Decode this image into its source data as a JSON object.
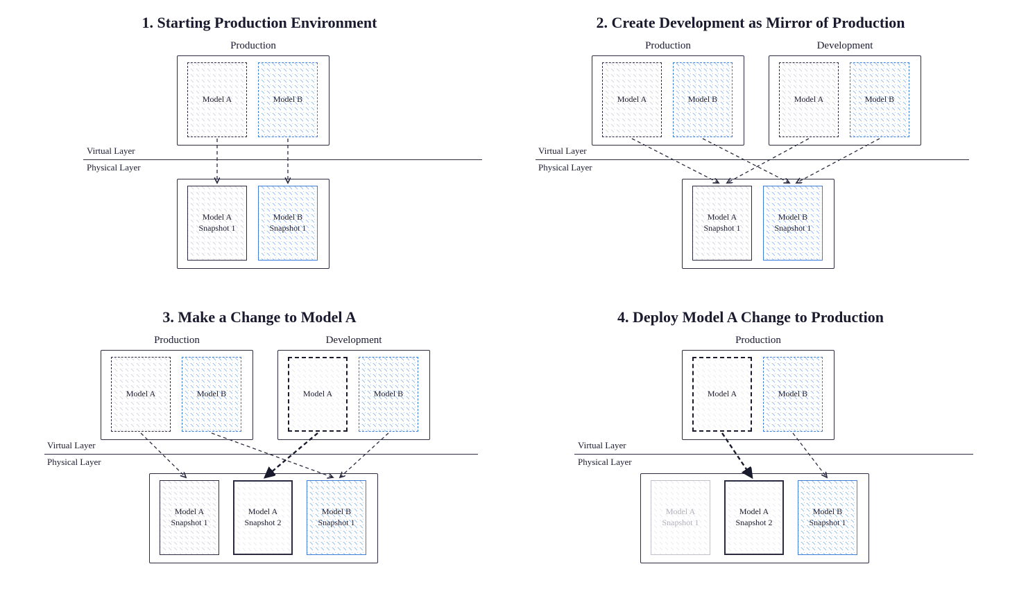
{
  "panels": {
    "p1": {
      "title": "1. Starting Production Environment",
      "envs": {
        "prod": "Production"
      },
      "models": {
        "a": "Model A",
        "b": "Model B",
        "as1": "Model A\nSnapshot 1",
        "bs1": "Model B\nSnapshot 1"
      }
    },
    "p2": {
      "title": "2. Create Development as Mirror of Production",
      "envs": {
        "prod": "Production",
        "dev": "Development"
      },
      "models": {
        "a": "Model A",
        "b": "Model B",
        "as1": "Model A\nSnapshot 1",
        "bs1": "Model B\nSnapshot 1"
      }
    },
    "p3": {
      "title": "3. Make a Change to Model A",
      "envs": {
        "prod": "Production",
        "dev": "Development"
      },
      "models": {
        "a": "Model A",
        "b": "Model B",
        "as1": "Model A\nSnapshot 1",
        "as2": "Model A\nSnapshot 2",
        "bs1": "Model B\nSnapshot 1"
      }
    },
    "p4": {
      "title": "4. Deploy Model A Change to Production",
      "envs": {
        "prod": "Production"
      },
      "models": {
        "a": "Model A",
        "b": "Model B",
        "as1": "Model A\nSnapshot 1",
        "as2": "Model A\nSnapshot 2",
        "bs1": "Model B\nSnapshot 1"
      }
    }
  },
  "layers": {
    "virtual": "Virtual Layer",
    "physical": "Physical Layer"
  }
}
